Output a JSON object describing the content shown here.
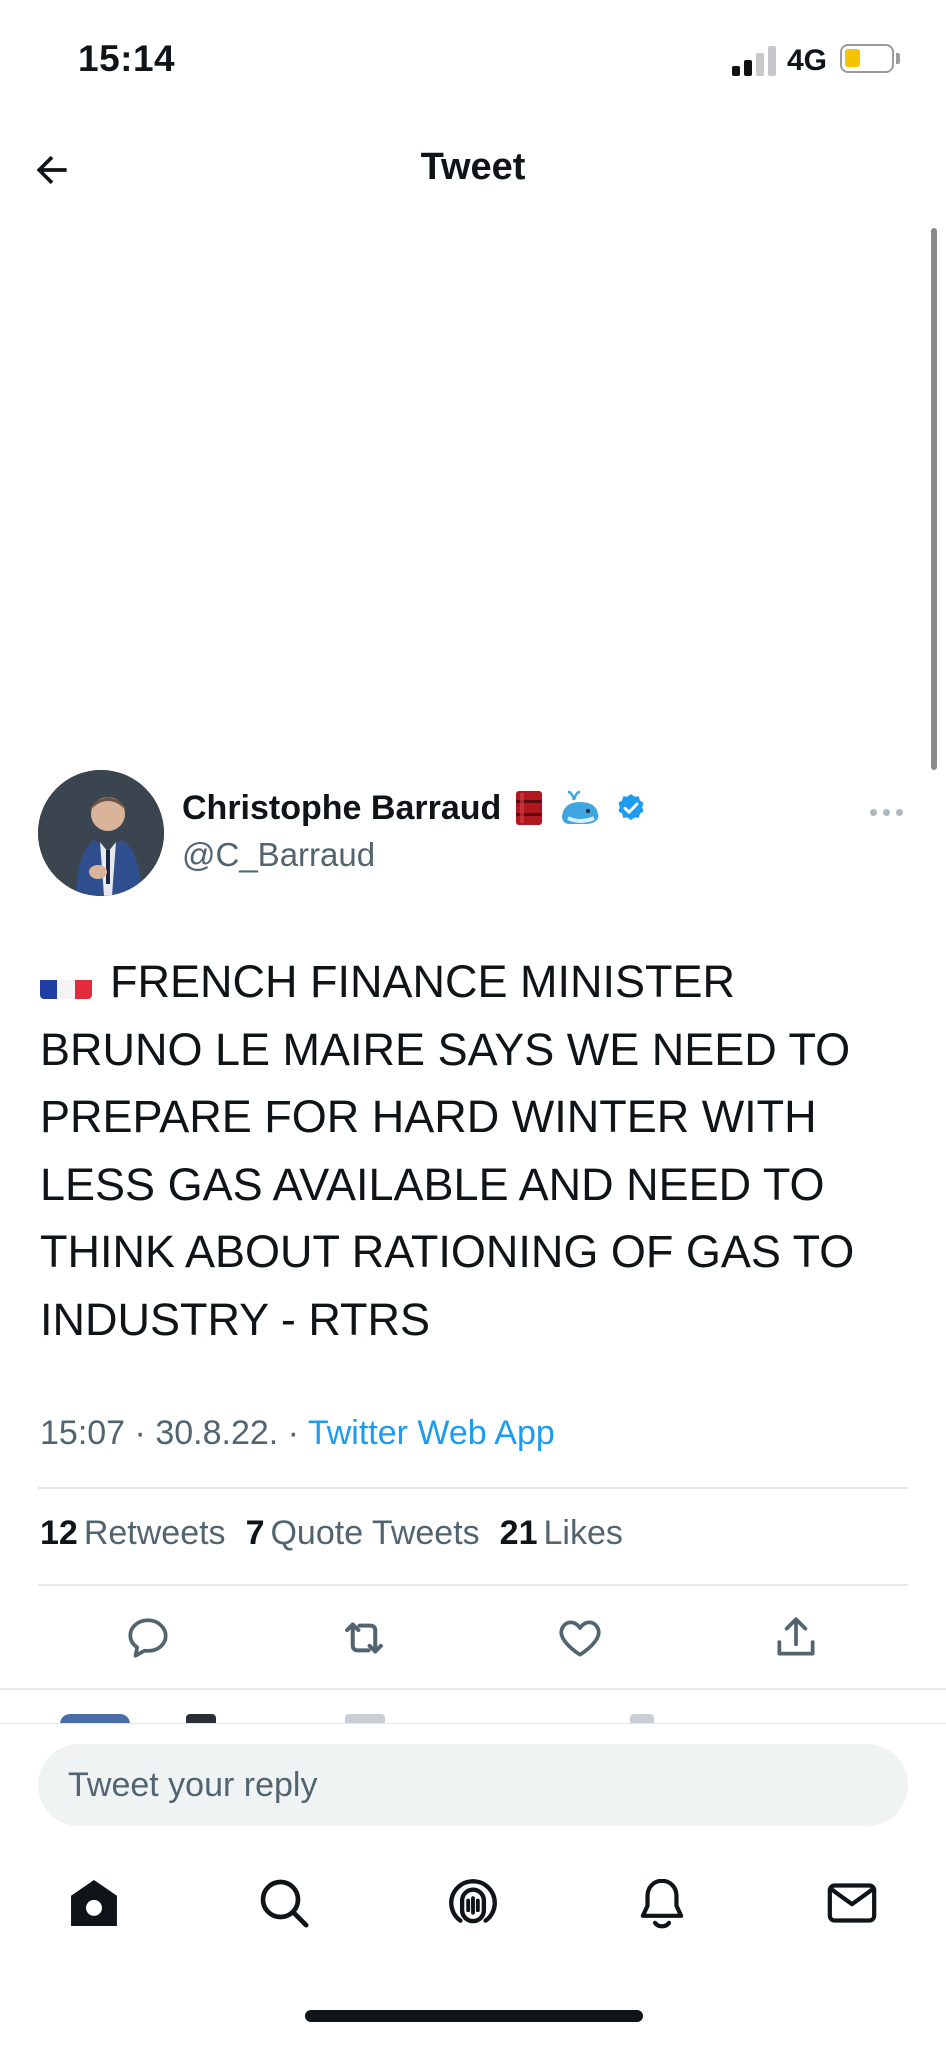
{
  "status_bar": {
    "time": "15:14",
    "network": "4G",
    "signal_bars_active": 2,
    "signal_bars_total": 4,
    "battery_level": 0.3,
    "battery_color": "#f5c300"
  },
  "header": {
    "title": "Tweet",
    "back_icon": "arrow-left-icon"
  },
  "tweet": {
    "author": {
      "name": "Christophe Barraud",
      "handle": "@C_Barraud",
      "badges": [
        "oil-drum-emoji",
        "whale-emoji",
        "verified-badge"
      ],
      "verified_color": "#1d9bf0"
    },
    "text": "FRENCH FINANCE MINISTER BRUNO LE MAIRE SAYS WE NEED TO PREPARE FOR HARD WINTER WITH LESS GAS AVAILABLE AND NEED TO THINK ABOUT RATIONING OF GAS TO INDUSTRY - RTRS",
    "flag": "france-flag",
    "time": "15:07",
    "date": "30.8.22.",
    "source": "Twitter Web App",
    "separator": "·"
  },
  "stats": {
    "retweets_count": "12",
    "retweets_label": "Retweets",
    "quotes_count": "7",
    "quotes_label": "Quote Tweets",
    "likes_count": "21",
    "likes_label": "Likes"
  },
  "actions": [
    "reply-icon",
    "retweet-icon",
    "like-icon",
    "share-icon"
  ],
  "reply": {
    "placeholder": "Tweet your reply"
  },
  "tab_bar": [
    "home-icon",
    "search-icon",
    "spaces-icon",
    "notifications-icon",
    "messages-icon"
  ],
  "colors": {
    "accent": "#1d9bf0",
    "text": "#0f1419",
    "secondary": "#536471"
  }
}
